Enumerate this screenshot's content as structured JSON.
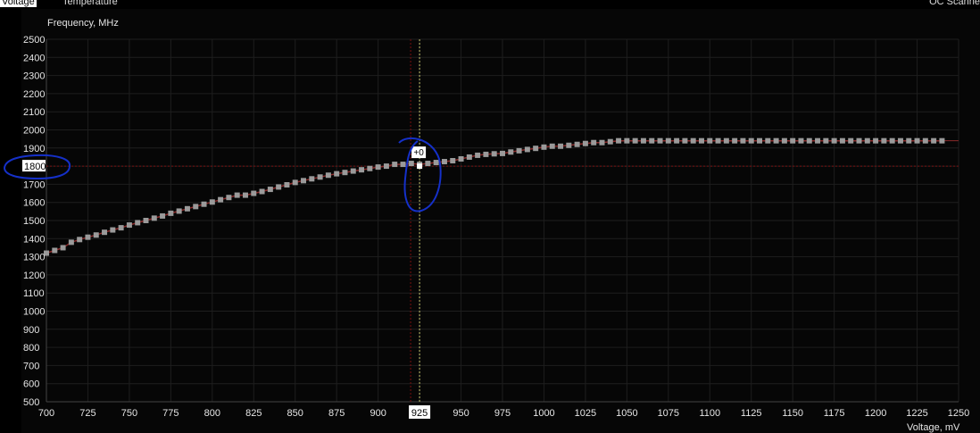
{
  "tabs": [
    {
      "label": "Voltage",
      "active": true
    },
    {
      "label": "Temperature",
      "active": false
    }
  ],
  "scanner_label": "OC Scanne",
  "chart_data": {
    "type": "line",
    "title": "",
    "ylabel": "Frequency, MHz",
    "xlabel": "Voltage, mV",
    "xlim": [
      700,
      1250
    ],
    "ylim": [
      500,
      2500
    ],
    "xticks": [
      700,
      725,
      750,
      775,
      800,
      825,
      850,
      875,
      900,
      925,
      950,
      975,
      1000,
      1025,
      1050,
      1075,
      1100,
      1125,
      1150,
      1175,
      1200,
      1225,
      1250
    ],
    "yticks": [
      500,
      600,
      700,
      800,
      900,
      1000,
      1100,
      1200,
      1300,
      1400,
      1500,
      1600,
      1700,
      1800,
      1900,
      2000,
      2100,
      2200,
      2300,
      2400,
      2500
    ],
    "grid": true,
    "selected_voltage": 925,
    "selected_frequency": 1800,
    "offset_label": "+0",
    "series": [
      {
        "color": "#9a9a9a",
        "points": [
          [
            700,
            1320
          ],
          [
            705,
            1335
          ],
          [
            710,
            1350
          ],
          [
            715,
            1380
          ],
          [
            720,
            1395
          ],
          [
            725,
            1408
          ],
          [
            730,
            1420
          ],
          [
            735,
            1435
          ],
          [
            740,
            1448
          ],
          [
            745,
            1460
          ],
          [
            750,
            1475
          ],
          [
            755,
            1488
          ],
          [
            760,
            1500
          ],
          [
            765,
            1513
          ],
          [
            770,
            1525
          ],
          [
            775,
            1540
          ],
          [
            780,
            1552
          ],
          [
            785,
            1565
          ],
          [
            790,
            1577
          ],
          [
            795,
            1590
          ],
          [
            800,
            1602
          ],
          [
            805,
            1615
          ],
          [
            810,
            1627
          ],
          [
            815,
            1640
          ],
          [
            820,
            1640
          ],
          [
            825,
            1650
          ],
          [
            830,
            1660
          ],
          [
            835,
            1672
          ],
          [
            840,
            1685
          ],
          [
            845,
            1697
          ],
          [
            850,
            1710
          ],
          [
            855,
            1720
          ],
          [
            860,
            1730
          ],
          [
            865,
            1740
          ],
          [
            870,
            1750
          ],
          [
            875,
            1758
          ],
          [
            880,
            1765
          ],
          [
            885,
            1773
          ],
          [
            890,
            1780
          ],
          [
            895,
            1787
          ],
          [
            900,
            1795
          ],
          [
            905,
            1800
          ],
          [
            910,
            1810
          ],
          [
            915,
            1810
          ],
          [
            920,
            1815
          ],
          [
            925,
            1810
          ],
          [
            930,
            1815
          ],
          [
            935,
            1820
          ],
          [
            940,
            1825
          ],
          [
            945,
            1830
          ],
          [
            950,
            1840
          ],
          [
            955,
            1850
          ],
          [
            960,
            1860
          ],
          [
            965,
            1865
          ],
          [
            970,
            1868
          ],
          [
            975,
            1870
          ],
          [
            980,
            1878
          ],
          [
            985,
            1885
          ],
          [
            990,
            1892
          ],
          [
            995,
            1898
          ],
          [
            1000,
            1905
          ],
          [
            1005,
            1910
          ],
          [
            1010,
            1910
          ],
          [
            1015,
            1915
          ],
          [
            1020,
            1920
          ],
          [
            1025,
            1925
          ],
          [
            1030,
            1930
          ],
          [
            1035,
            1930
          ],
          [
            1040,
            1935
          ],
          [
            1045,
            1940
          ],
          [
            1050,
            1940
          ],
          [
            1055,
            1940
          ],
          [
            1060,
            1940
          ],
          [
            1065,
            1940
          ],
          [
            1070,
            1940
          ],
          [
            1075,
            1940
          ],
          [
            1080,
            1940
          ],
          [
            1085,
            1940
          ],
          [
            1090,
            1940
          ],
          [
            1095,
            1940
          ],
          [
            1100,
            1940
          ],
          [
            1105,
            1940
          ],
          [
            1110,
            1940
          ],
          [
            1115,
            1940
          ],
          [
            1120,
            1940
          ],
          [
            1125,
            1940
          ],
          [
            1130,
            1940
          ],
          [
            1135,
            1940
          ],
          [
            1140,
            1940
          ],
          [
            1145,
            1940
          ],
          [
            1150,
            1940
          ],
          [
            1155,
            1940
          ],
          [
            1160,
            1940
          ],
          [
            1165,
            1940
          ],
          [
            1170,
            1940
          ],
          [
            1175,
            1940
          ],
          [
            1180,
            1940
          ],
          [
            1185,
            1940
          ],
          [
            1190,
            1940
          ],
          [
            1195,
            1940
          ],
          [
            1200,
            1940
          ],
          [
            1205,
            1940
          ],
          [
            1210,
            1940
          ],
          [
            1215,
            1940
          ],
          [
            1220,
            1940
          ],
          [
            1225,
            1940
          ],
          [
            1230,
            1940
          ],
          [
            1235,
            1940
          ],
          [
            1240,
            1940
          ]
        ]
      }
    ],
    "colors": {
      "grid": "#1e1e1e",
      "curve": "#8a2a2a",
      "marker": "#9a9a9a",
      "crosshair_v": "#c8c86e",
      "guide": "#7a1010",
      "annotation": "#1530c8"
    }
  }
}
